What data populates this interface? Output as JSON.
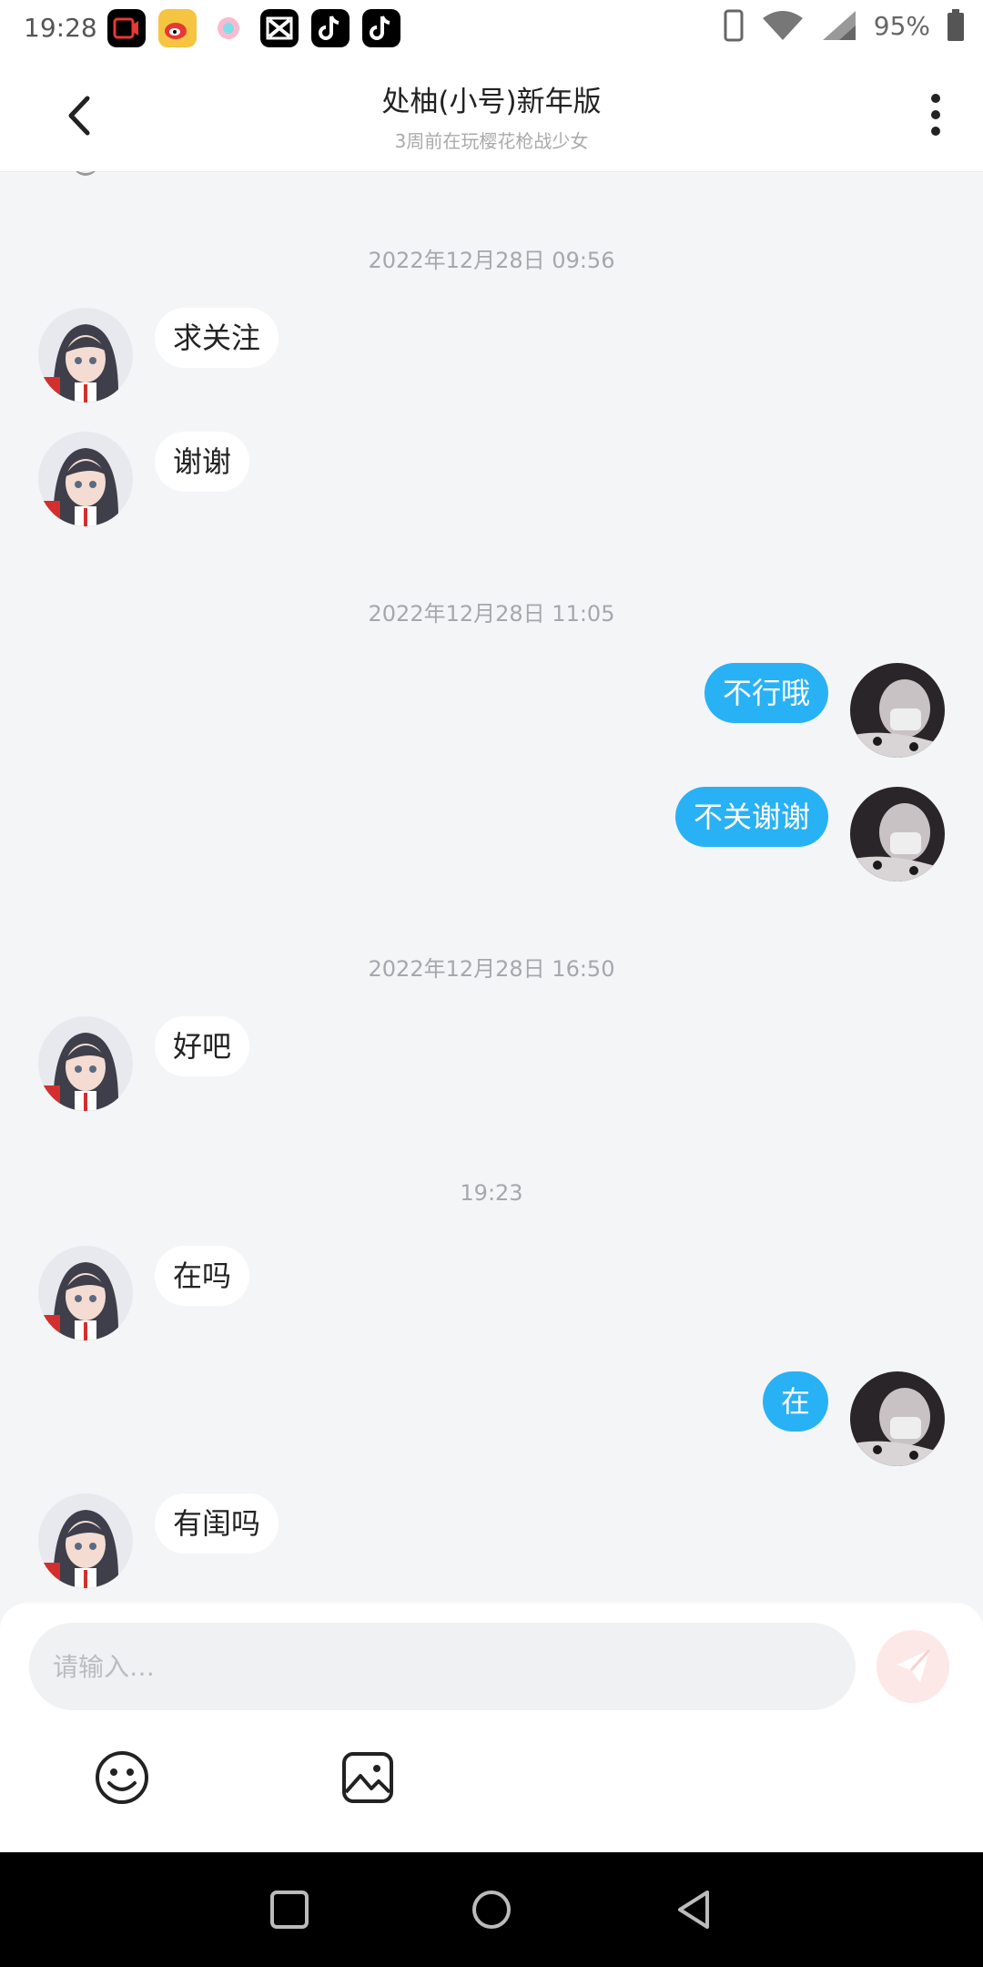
{
  "status": {
    "time": "19:28",
    "battery": "95%",
    "apps": [
      {
        "name": "video-app-icon",
        "color": "#000000",
        "accent": "#e53935"
      },
      {
        "name": "weibo-icon",
        "color": "#f5c542",
        "accent": "#e53935"
      },
      {
        "name": "flower-app-icon",
        "color": "#ffffff",
        "accent": "#f06292"
      },
      {
        "name": "capcut-icon",
        "color": "#000000",
        "accent": "#ffffff"
      },
      {
        "name": "tiktok-icon",
        "color": "#000000",
        "accent": "#ffffff"
      },
      {
        "name": "tiktok-icon",
        "color": "#000000",
        "accent": "#ffffff"
      }
    ]
  },
  "header": {
    "title": "处柚(小号)新年版",
    "subtitle": "3周前在玩樱花枪战少女"
  },
  "messages": [
    {
      "type": "time",
      "text": "2022年12月28日 09:56"
    },
    {
      "type": "in",
      "text": "求关注"
    },
    {
      "type": "in",
      "text": "谢谢"
    },
    {
      "type": "time",
      "text": "2022年12月28日 11:05"
    },
    {
      "type": "out",
      "text": "不行哦"
    },
    {
      "type": "out",
      "text": "不关谢谢"
    },
    {
      "type": "time",
      "text": "2022年12月28日 16:50"
    },
    {
      "type": "in",
      "text": "好吧"
    },
    {
      "type": "time",
      "text": "19:23"
    },
    {
      "type": "in",
      "text": "在吗"
    },
    {
      "type": "out",
      "text": "在"
    },
    {
      "type": "in",
      "text": "有闺吗"
    }
  ],
  "composer": {
    "placeholder": "请输入…"
  },
  "colors": {
    "outgoing_bubble": "#29b1f5",
    "incoming_bubble": "#ffffff",
    "background": "#f4f5f7",
    "send_button_bg": "#fde8e8"
  },
  "icons": {
    "back": "chevron-left-icon",
    "more": "more-vertical-icon",
    "send": "paper-plane-icon",
    "emoji": "smiley-icon",
    "image": "image-icon",
    "nav": [
      "square-icon",
      "circle-icon",
      "triangle-left-icon"
    ]
  }
}
